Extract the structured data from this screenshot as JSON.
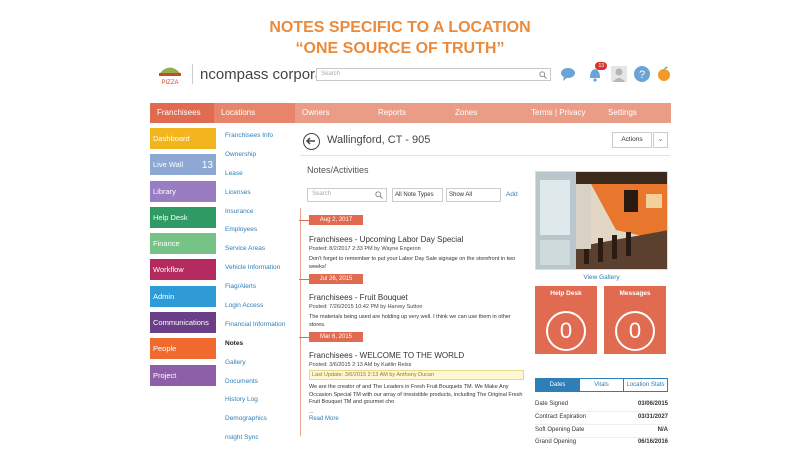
{
  "headline": {
    "line1": "NOTES SPECIFIC TO A LOCATION",
    "line2": "“ONE SOURCE OF TRUTH”"
  },
  "app": {
    "logo_text": "PIZZA",
    "brand": "ncompass corporate",
    "search_placeholder": "Search",
    "notification_count": "13"
  },
  "colors": {
    "accent": "#e06b51",
    "link": "#2e7fb8",
    "headline": "#ec8a3b"
  },
  "nav": [
    {
      "label": "Franchisees",
      "color": "#e06b51"
    },
    {
      "label": "Locations",
      "color": "#e8846a"
    },
    {
      "label": "Owners",
      "color": "#eb9c86"
    },
    {
      "label": "Reports",
      "color": "#eb9c86"
    },
    {
      "label": "Zones",
      "color": "#eb9c86"
    },
    {
      "label": "Terms | Privacy",
      "color": "#eb9c86"
    },
    {
      "label": "Settings",
      "color": "#eb9c86"
    }
  ],
  "sidebar": [
    {
      "label": "Dashboard",
      "color": "#f2b51d",
      "count": ""
    },
    {
      "label": "Live Wall",
      "color": "#8ea8d4",
      "count": "13"
    },
    {
      "label": "Library",
      "color": "#9a7cc2",
      "count": ""
    },
    {
      "label": "Help Desk",
      "color": "#2f9a63",
      "count": ""
    },
    {
      "label": "Finance",
      "color": "#77c286",
      "count": ""
    },
    {
      "label": "Workflow",
      "color": "#b52a5e",
      "count": ""
    },
    {
      "label": "Admin",
      "color": "#2f9bd6",
      "count": ""
    },
    {
      "label": "Communications",
      "color": "#6a3f88",
      "count": ""
    },
    {
      "label": "People",
      "color": "#f0692f",
      "count": ""
    },
    {
      "label": "Project",
      "color": "#8d5fa8",
      "count": ""
    }
  ],
  "subnav": [
    "Franchisees Info",
    "Ownership",
    "Lease",
    "Licenses",
    "Insurance",
    "Employees",
    "Service Areas",
    "Vehicle Information",
    "Flag/Alerts",
    "Login Access",
    "Financial Information",
    "Notes",
    "Gallery",
    "Documents",
    "History Log",
    "Demographics",
    "nsight Sync"
  ],
  "subnav_active": "Notes",
  "location": {
    "title": "Wallingford, CT - 905",
    "actions_label": "Actions"
  },
  "notes": {
    "title": "Notes/Activities",
    "search_placeholder": "Search",
    "type_filter": "All Note Types",
    "show_filter": "Show All",
    "add_label": "Add",
    "entries": [
      {
        "date": "Aug 2, 2017",
        "title": "Franchisees - Upcoming Labor Day Special",
        "meta": "Posted: 8/2/2017 2:33 PM by Wayne Engeron",
        "body": "Don't forget to remember to put your Labor Day Sale signage on the storefront in two weeks!"
      },
      {
        "date": "Jul 26, 2015",
        "title": "Franchisees - Fruit Bouquet",
        "meta": "Posted: 7/26/2015 10:42 PM by Harvey Sutton",
        "body": "The materials being used are holding up very well. I think we can use them in other stores."
      },
      {
        "date": "Mar 6, 2015",
        "title": "Franchisees - WELCOME TO THE WORLD",
        "meta": "Posted: 3/6/2015 2:13 AM by Kaitlin Reiss",
        "last_update": "Last Update: 3/6/2015 2:13 AM by Anthony Ducan",
        "body": "We are the creator of and The Leaders in Fresh Fruit Bouquets TM. We Make Any Occasion Special TM with our array of irresistible products, including The Original Fresh Fruit Bouquet TM and gourmet cho",
        "ellipsis": "...",
        "read_more": "Read More"
      }
    ]
  },
  "right_panel": {
    "gallery_link": "View Gallery",
    "help_desk": {
      "label": "Help Desk",
      "value": "0"
    },
    "messages": {
      "label": "Messages",
      "value": "0"
    },
    "tabs": [
      "Dates",
      "Vitals",
      "Location Stats"
    ],
    "dates": [
      {
        "label": "Date Signed",
        "value": "03/06/2015"
      },
      {
        "label": "Contract Expiration",
        "value": "03/31/2027"
      },
      {
        "label": "Soft Opening Date",
        "value": "N/A"
      },
      {
        "label": "Grand Opening",
        "value": "06/16/2016"
      }
    ]
  }
}
